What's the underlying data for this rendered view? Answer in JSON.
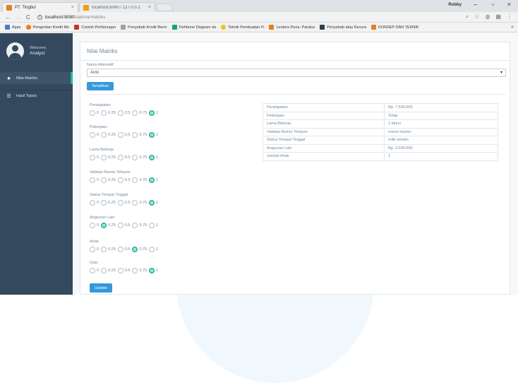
{
  "browser": {
    "tabs": [
      {
        "title": "PT. Tingbul",
        "close": "×"
      },
      {
        "title": "localhost:8080 / 127.0.0.1",
        "close": "×"
      }
    ],
    "user": "Robby",
    "controls": {
      "min": "–",
      "max": "▫",
      "close": "×"
    },
    "url_host": "localhost:8080",
    "url_path": "/saitma/matriks",
    "bookmarks": [
      "Apps",
      "Pengertian Kredit Mo",
      "Contoh Perhitungan",
      "Penyebab Kredit Berm",
      "Fishbone Diagram da",
      "Teknik Pembuatan Fi",
      "Lentera Pena: Panduz",
      "Penyebab atau Kecura",
      "KONSEP DAN TEKNIK"
    ],
    "more": "»"
  },
  "sidebar": {
    "welcome": "Welcome,",
    "user": "Analyst",
    "items": [
      {
        "label": "Nilai Matriks",
        "icon": "star-icon"
      },
      {
        "label": "Hasil Topsis",
        "icon": "table-icon"
      }
    ]
  },
  "main": {
    "title": "Nilai Matriks",
    "select_label": "Nama Alternatif",
    "select_value": "Anto",
    "show_button": "Tampilkan",
    "update_button": "Update",
    "criteria": [
      {
        "label": "Pendapatan",
        "selected": 4
      },
      {
        "label": "Pekerjaan",
        "selected": 4
      },
      {
        "label": "Lama Bekerja",
        "selected": 4
      },
      {
        "label": "Validasi Nomor Telepon",
        "selected": 4
      },
      {
        "label": "Status Tempat Tinggal",
        "selected": 4
      },
      {
        "label": "Angsuran Lain",
        "selected": 1
      },
      {
        "label": "Anak",
        "selected": 3
      },
      {
        "label": "Usia",
        "selected": 4
      }
    ],
    "options": [
      "0",
      "0.25",
      "0.5",
      "0.75",
      "1"
    ],
    "info_table": [
      {
        "key": "Pendapatan",
        "value": "Rp. 7.500.000"
      },
      {
        "key": "Pekerjaan",
        "value": "Tetap"
      },
      {
        "key": "Lama Bekerja",
        "value": "1 tahun"
      },
      {
        "key": "Validasi Nomor Telepon",
        "value": "nomor kantor"
      },
      {
        "key": "Status Tempat Tinggal",
        "value": "milik sendiri"
      },
      {
        "key": "Angsuran Lain",
        "value": "Rp. 2.500.000"
      },
      {
        "key": "Jumlah Anak",
        "value": "1"
      }
    ]
  }
}
